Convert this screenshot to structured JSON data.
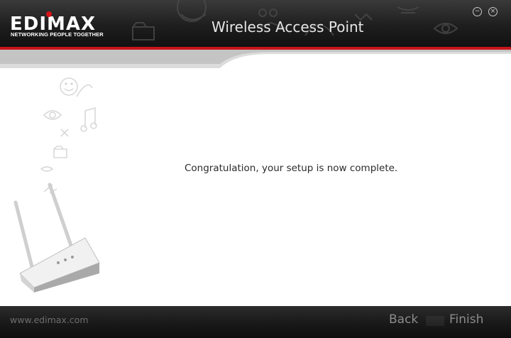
{
  "brand": {
    "name": "EDIMAX",
    "tagline": "NETWORKING PEOPLE TOGETHER"
  },
  "window": {
    "title": "Wireless Access Point",
    "minimize_icon": "minimize-icon",
    "close_icon": "close-icon"
  },
  "main": {
    "message": "Congratulation, your setup is now complete."
  },
  "footer": {
    "website": "www.edimax.com",
    "back_label": "Back",
    "finish_label": "Finish"
  },
  "colors": {
    "accent_red": "#c8151b",
    "header_bg": "#1e1e1e",
    "footer_bg": "#1a1a1a"
  }
}
